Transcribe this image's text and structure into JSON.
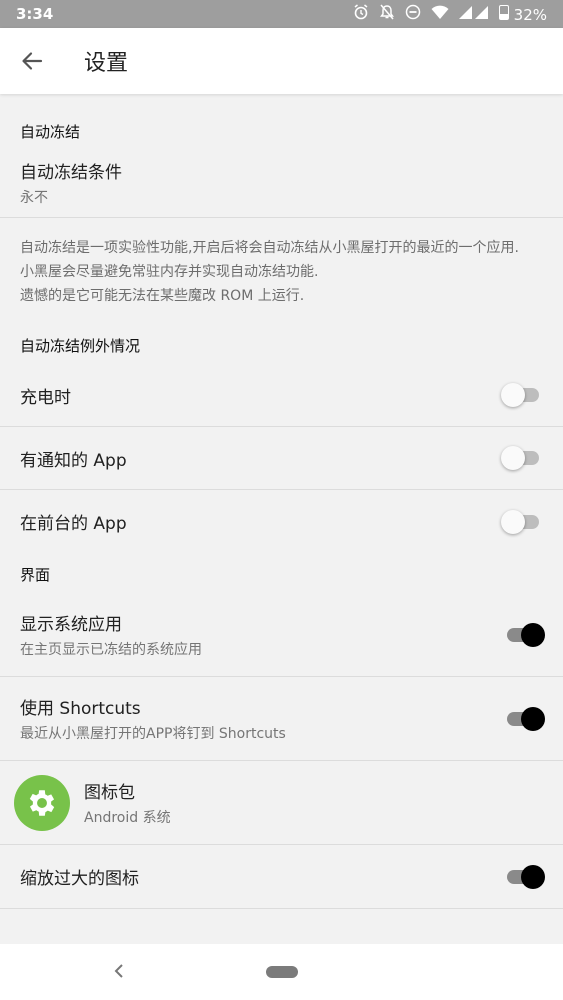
{
  "status_bar": {
    "time": "3:34",
    "battery": "32%",
    "icons": [
      "alarm-icon",
      "notifications-off-icon",
      "do-not-disturb-icon",
      "wifi-icon",
      "signal-icon",
      "battery-icon"
    ]
  },
  "app_bar": {
    "title": "设置"
  },
  "auto_freeze": {
    "header": "自动冻结",
    "condition": {
      "title": "自动冻结条件",
      "summary": "永不"
    },
    "note": {
      "line1": "自动冻结是一项实验性功能,开启后将会自动冻结从小黑屋打开的最近的一个应用.",
      "line2": "小黑屋会尽量避免常驻内存并实现自动冻结功能.",
      "line3": "遗憾的是它可能无法在某些魔改 ROM 上运行."
    }
  },
  "exceptions": {
    "header": "自动冻结例外情况",
    "items": [
      {
        "title": "充电时",
        "on": false
      },
      {
        "title": "有通知的 App",
        "on": false
      },
      {
        "title": "在前台的 App",
        "on": false
      }
    ]
  },
  "interface": {
    "header": "界面",
    "show_system": {
      "title": "显示系统应用",
      "summary": "在主页显示已冻结的系统应用",
      "on": true
    },
    "shortcuts": {
      "title": "使用 Shortcuts",
      "summary": "最近从小黑屋打开的APP将钉到 Shortcuts",
      "on": true
    },
    "icon_pack": {
      "title": "图标包",
      "summary": "Android 系统",
      "icon": "settings-gear-icon"
    },
    "scale_icons": {
      "title": "缩放过大的图标",
      "on": true
    }
  },
  "colors": {
    "accent": "#000000",
    "icon_badge": "#78c24a",
    "background": "#f2f2f2"
  }
}
